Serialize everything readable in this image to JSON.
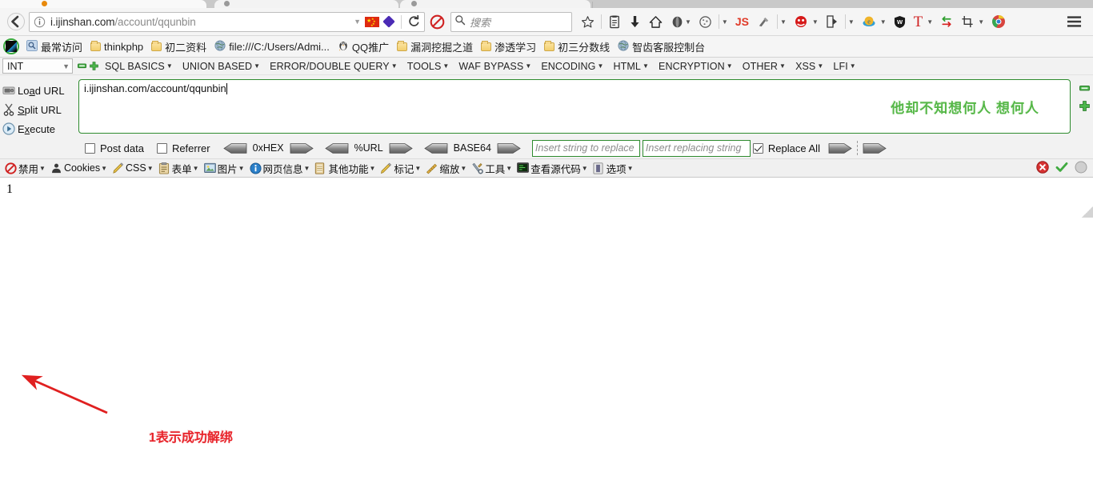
{
  "browser": {
    "back_label": "back-navigation",
    "url": {
      "host": "i.ijinshan.com",
      "path": "/account/qqunbin",
      "full": "i.ijinshan.com/account/qqunbin"
    },
    "identity_icon": "info-icon",
    "reload_label": "Reload",
    "search": {
      "placeholder": "搜索",
      "icon": "search-icon"
    },
    "toolbar_icons": [
      {
        "name": "bookmark-star-icon",
        "glyph": "☆"
      },
      {
        "name": "reading-list-icon",
        "glyph": "ὌB"
      },
      {
        "name": "downloads-icon",
        "glyph": "↓"
      },
      {
        "name": "home-icon",
        "glyph": "⌂"
      },
      {
        "name": "firebug-icon",
        "glyph": "●"
      },
      {
        "name": "cookie-manager-icon",
        "glyph": "◌"
      },
      {
        "name": "javascript-toggle-icon",
        "glyph": "JS"
      },
      {
        "name": "wappalyzer-icon",
        "glyph": "✱"
      },
      {
        "name": "hackbar-icon",
        "glyph": "●"
      },
      {
        "name": "tamper-data-icon",
        "glyph": "⎙"
      },
      {
        "name": "ie-tab-icon",
        "glyph": "e"
      },
      {
        "name": "adblock-shield-icon",
        "glyph": "●"
      },
      {
        "name": "text-tool-icon",
        "glyph": "T"
      },
      {
        "name": "proxy-switch-icon",
        "glyph": "⇄"
      },
      {
        "name": "screenshot-crop-icon",
        "glyph": "✀"
      },
      {
        "name": "chrome-launch-icon",
        "glyph": "●"
      },
      {
        "name": "menu-hamburger-icon",
        "glyph": "≡"
      }
    ]
  },
  "bookmarks": [
    {
      "name": "dark-reader-swatch",
      "label": "",
      "icon": "swatch"
    },
    {
      "name": "most-visited",
      "label": "最常访问",
      "icon": "magnifier"
    },
    {
      "name": "thinkphp",
      "label": "thinkphp",
      "icon": "folder"
    },
    {
      "name": "grade2-materials",
      "label": "初二资料",
      "icon": "folder"
    },
    {
      "name": "local-file",
      "label": "file:///C:/Users/Admi...",
      "icon": "globe"
    },
    {
      "name": "qq-promo",
      "label": "QQ推广",
      "icon": "qq-penguin"
    },
    {
      "name": "vuln-mining",
      "label": "漏洞挖掘之道",
      "icon": "folder"
    },
    {
      "name": "pentest-study",
      "label": "渗透学习",
      "icon": "folder"
    },
    {
      "name": "grade3-scoreline",
      "label": "初三分数线",
      "icon": "folder"
    },
    {
      "name": "zhichi-console",
      "label": "智齿客服控制台",
      "icon": "globe"
    }
  ],
  "hackbar": {
    "type_select": {
      "value": "INT",
      "caret": "⌄"
    },
    "tab_minus": "remove-tab-button",
    "tab_plus": "add-tab-button",
    "menus": [
      {
        "label": "SQL BASICS",
        "caret": "▾"
      },
      {
        "label": "UNION BASED",
        "caret": "▾"
      },
      {
        "label": "ERROR/DOUBLE QUERY",
        "caret": "▾"
      },
      {
        "label": "TOOLS",
        "caret": "▾"
      },
      {
        "label": "WAF BYPASS",
        "caret": "▾"
      },
      {
        "label": "ENCODING",
        "caret": "▾"
      },
      {
        "label": "HTML",
        "caret": "▾"
      },
      {
        "label": "ENCRYPTION",
        "caret": "▾"
      },
      {
        "label": "OTHER",
        "caret": "▾"
      },
      {
        "label": "XSS",
        "caret": "▾"
      },
      {
        "label": "LFI",
        "caret": "▾"
      }
    ],
    "actions": [
      {
        "name": "load-url",
        "pre": "Lo",
        "accel": "a",
        "post": "d URL",
        "icon": "load-url-icon"
      },
      {
        "name": "split-url",
        "pre": "",
        "accel": "S",
        "post": "plit URL",
        "icon": "scissors-icon"
      },
      {
        "name": "execute",
        "pre": "E",
        "accel": "x",
        "post": "ecute",
        "icon": "play-icon"
      }
    ],
    "request_textarea": {
      "value": "i.ijinshan.com/account/qqunbin"
    },
    "green_annotation": "他却不知想何人 想何人",
    "side_buttons": [
      {
        "name": "decrease-font-button",
        "kind": "minus"
      },
      {
        "name": "increase-font-button",
        "kind": "plus"
      }
    ],
    "options": {
      "post_data": {
        "label": "Post data",
        "checked": false
      },
      "referrer": {
        "label": "Referrer",
        "checked": false
      },
      "codecs": [
        {
          "label": "0xHEX",
          "name": "hex-codec"
        },
        {
          "label": "%URL",
          "name": "url-codec"
        },
        {
          "label": "BASE64",
          "name": "base64-codec"
        }
      ],
      "replace_search": {
        "placeholder": "Insert string to replace",
        "value": ""
      },
      "replace_with": {
        "placeholder": "Insert replacing string",
        "value": ""
      },
      "replace_all": {
        "label": "Replace All",
        "checked": true
      }
    }
  },
  "webdev_toolbar": {
    "items": [
      {
        "label": "禁用",
        "icon": "disable-icon",
        "caret": "▾"
      },
      {
        "label": "Cookies",
        "icon": "cookies-icon",
        "caret": "▾"
      },
      {
        "label": "CSS",
        "icon": "css-icon",
        "caret": "▾"
      },
      {
        "label": "表单",
        "icon": "forms-icon",
        "caret": "▾"
      },
      {
        "label": "图片",
        "icon": "images-icon",
        "caret": "▾"
      },
      {
        "label": "网页信息",
        "icon": "info-circle-icon",
        "caret": "▾"
      },
      {
        "label": "其他功能",
        "icon": "misc-icon",
        "caret": "▾"
      },
      {
        "label": "标记",
        "icon": "outline-pencil-icon",
        "caret": "▾"
      },
      {
        "label": "缩放",
        "icon": "resize-ruler-icon",
        "caret": "▾"
      },
      {
        "label": "工具",
        "icon": "tools-icon",
        "caret": "▾"
      },
      {
        "label": "查看源代码",
        "icon": "view-source-icon",
        "caret": "▾"
      },
      {
        "label": "选项",
        "icon": "options-icon",
        "caret": "▾"
      }
    ],
    "status": [
      {
        "name": "error-count-icon",
        "kind": "error"
      },
      {
        "name": "validation-ok-icon",
        "kind": "ok"
      },
      {
        "name": "idle-indicator-icon",
        "kind": "idle"
      }
    ]
  },
  "page": {
    "response_body": "1",
    "red_annotation": "1表示成功解绑",
    "arrow": "red-arrow-annotation"
  },
  "colors": {
    "hackbar_green": "#2e8b2e",
    "annotation_green": "#55b747",
    "annotation_red": "#e8232a",
    "chrome_grey": "#f5f5f5"
  }
}
